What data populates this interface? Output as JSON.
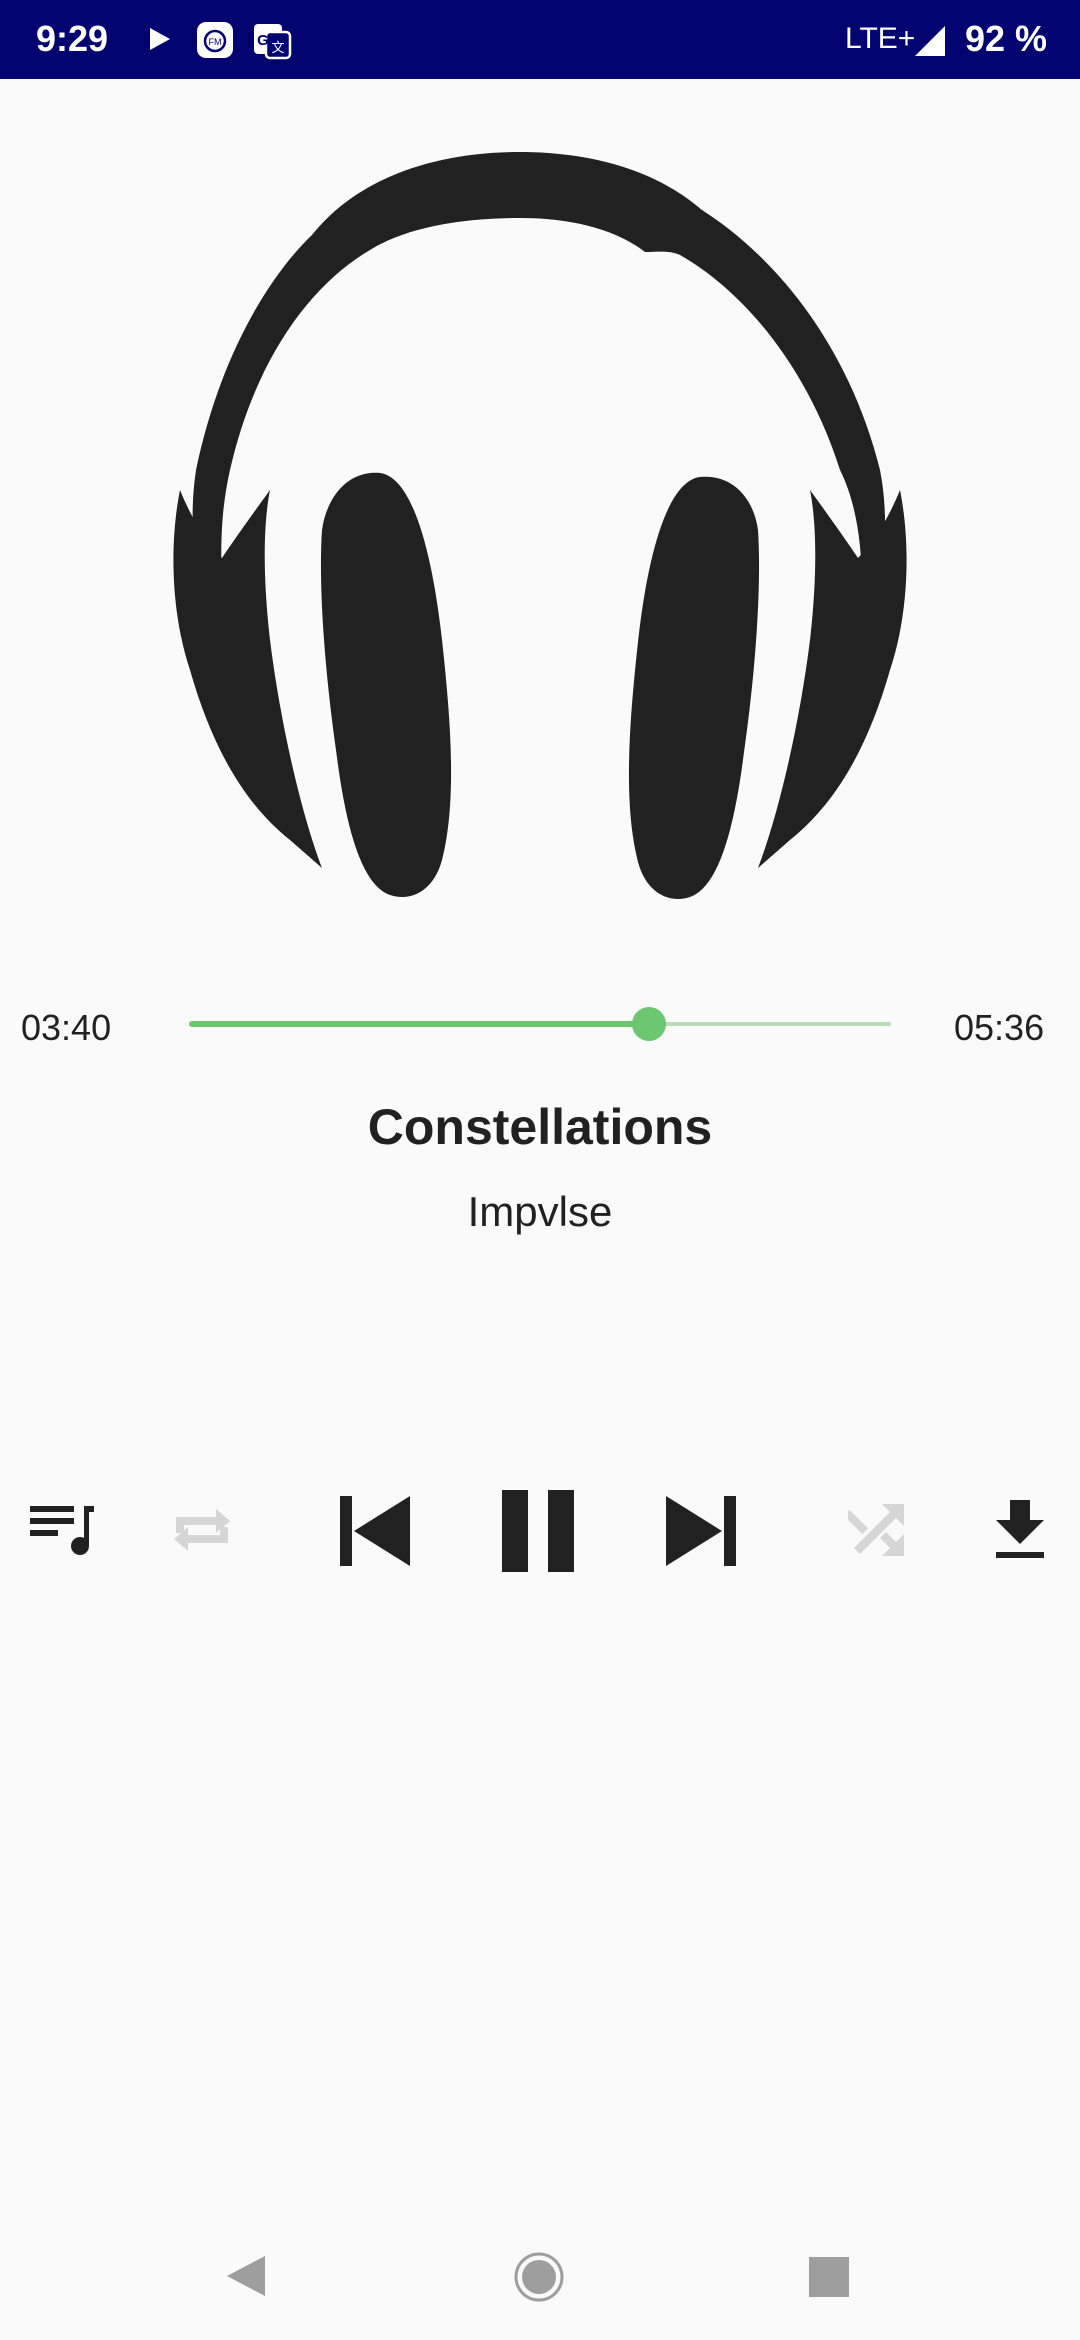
{
  "status_bar": {
    "time": "9:29",
    "network": "LTE+",
    "battery": "92 %"
  },
  "player": {
    "artwork_icon": "headphones-icon",
    "current_time": "03:40",
    "total_time": "05:36",
    "progress_fraction": 0.655,
    "track_title": "Constellations",
    "artist": "Impvlse"
  },
  "controls": {
    "queue_icon": "playlist-icon",
    "repeat_icon": "repeat-icon",
    "previous_icon": "skip-previous-icon",
    "pause_icon": "pause-icon",
    "next_icon": "skip-next-icon",
    "shuffle_icon": "shuffle-icon",
    "download_icon": "download-icon"
  },
  "colors": {
    "status_bar": "#020270",
    "accent": "#6cc870",
    "accent_track": "#b9dcb9",
    "icon_active": "#212121",
    "icon_disabled": "#d6d6d6"
  }
}
